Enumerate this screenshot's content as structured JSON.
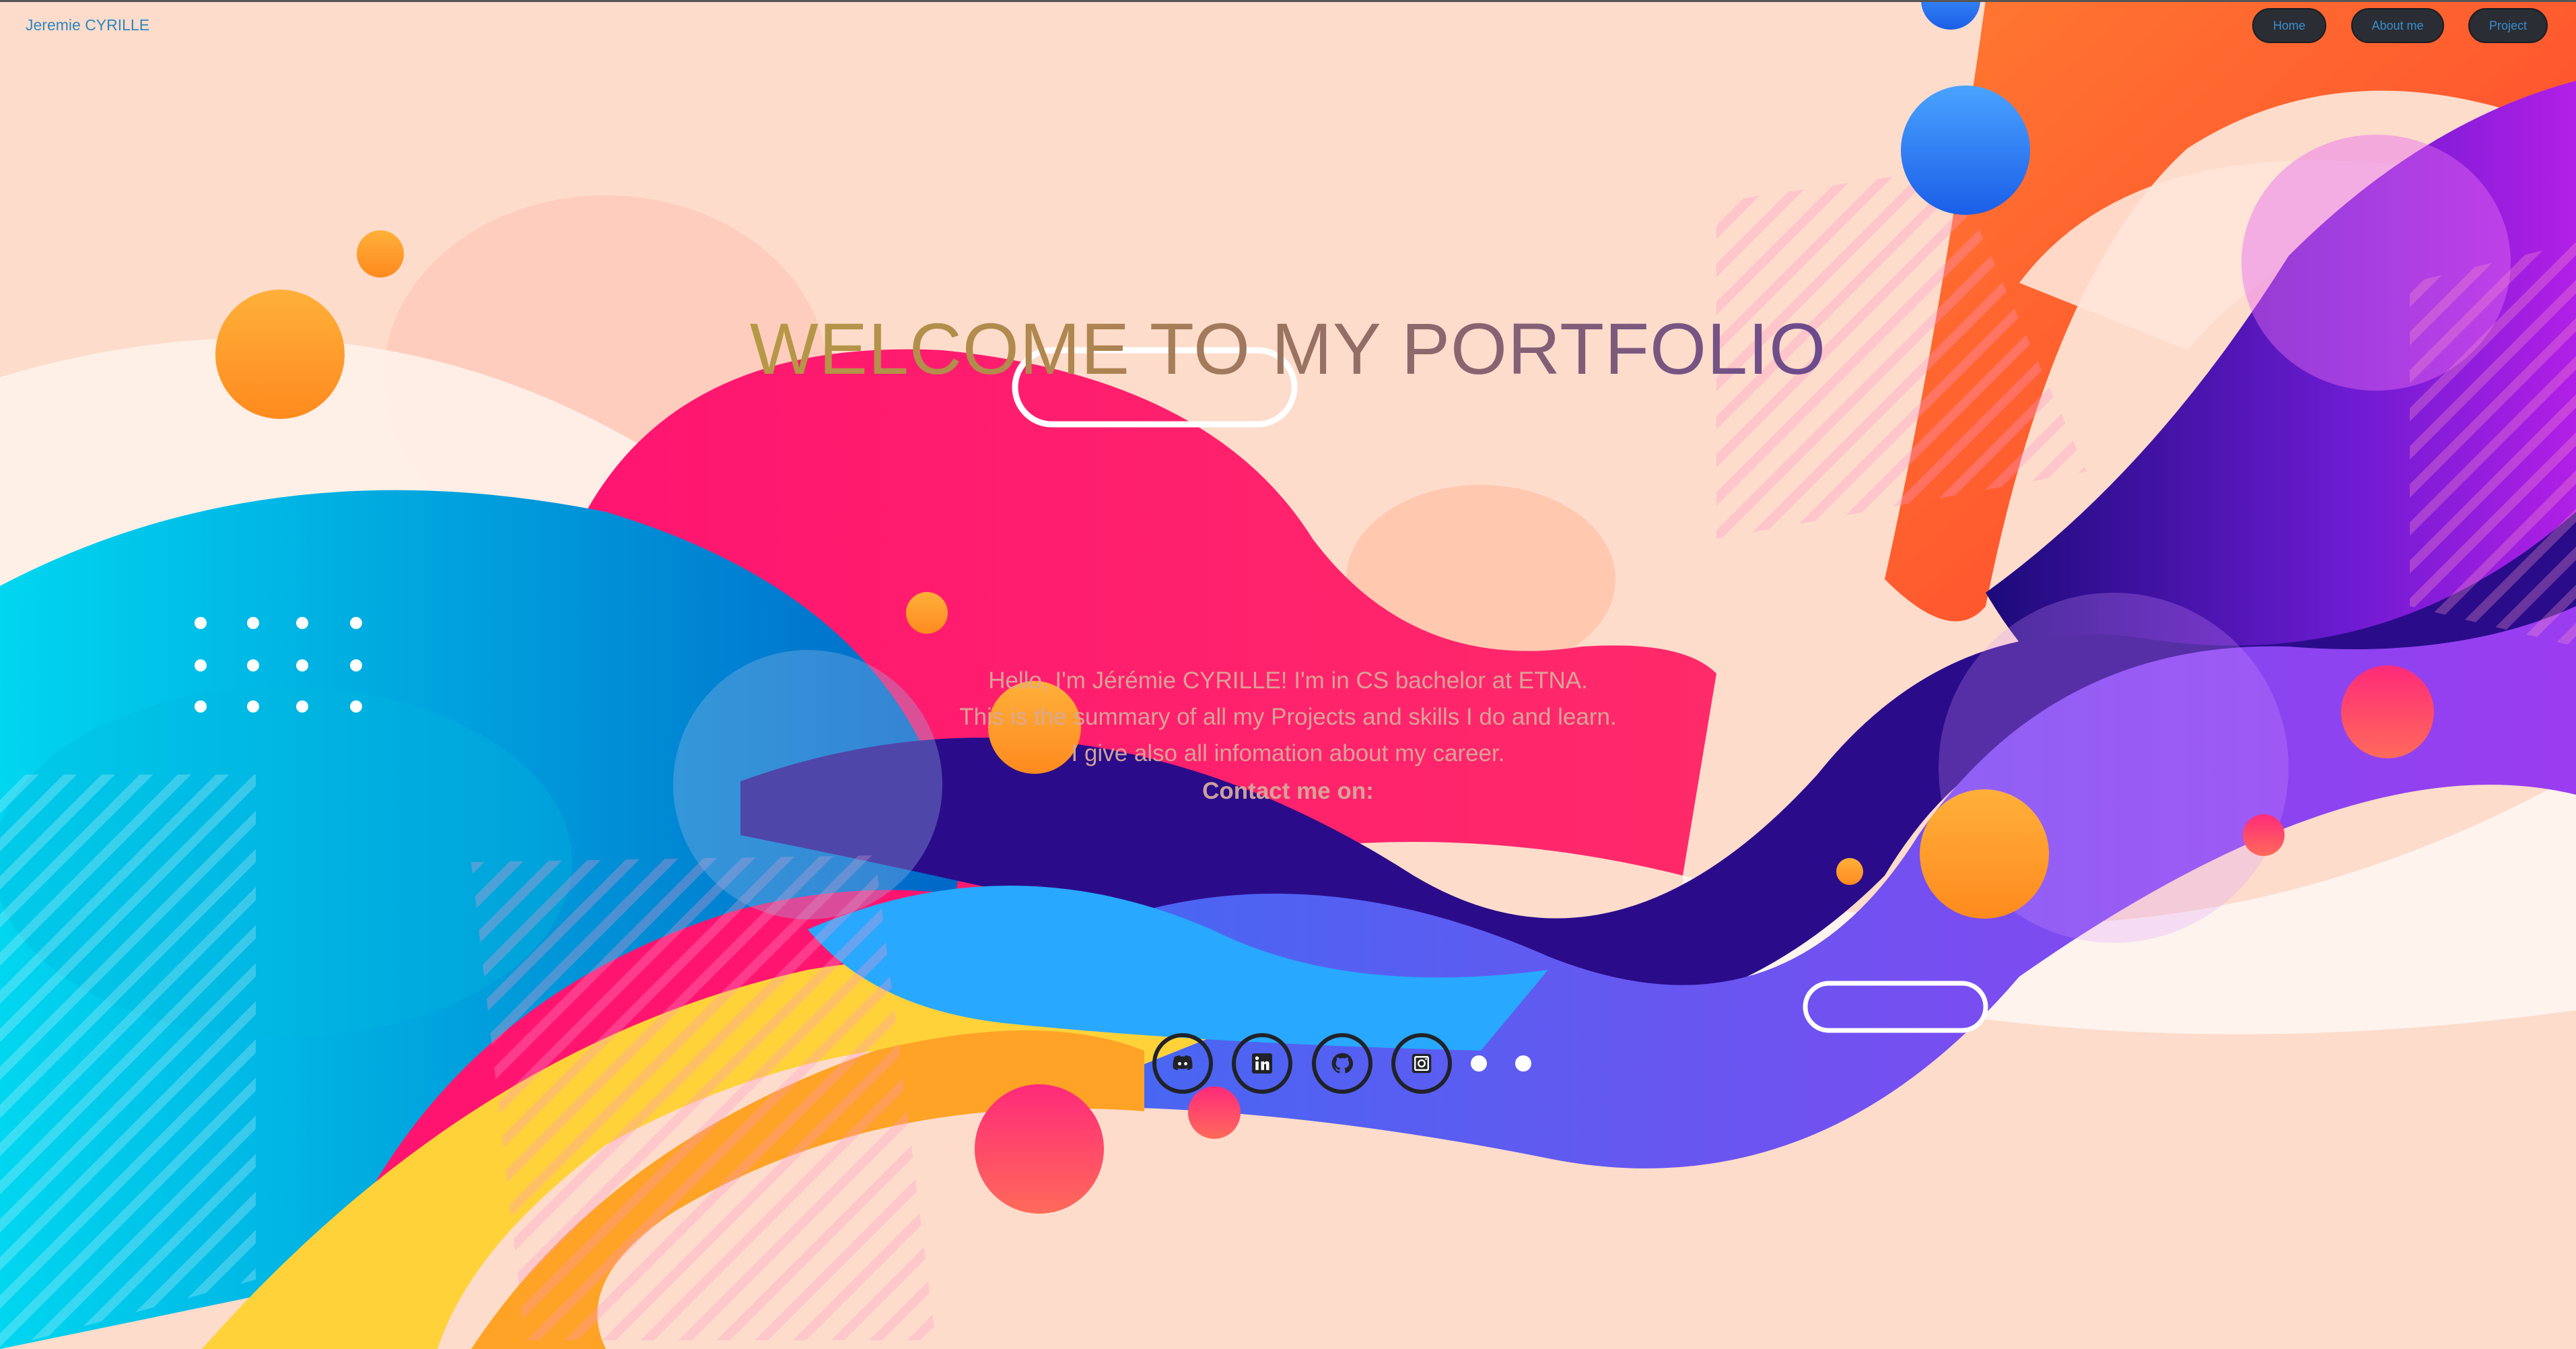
{
  "header": {
    "brand": "Jeremie CYRILLE",
    "nav": [
      {
        "label": "Home"
      },
      {
        "label": "About me"
      },
      {
        "label": "Project"
      }
    ]
  },
  "hero": {
    "title": "WELCOME TO MY PORTFOLIO",
    "intro_lines": [
      "Hello, I'm Jérémie CYRILLE! I'm in CS bachelor at ETNA.",
      "This is the summary of all my Projects and skills I do and learn.",
      "I give also all infomation about my career."
    ],
    "contact_label": "Contact me on:"
  },
  "socials": [
    {
      "icon": "discord-icon"
    },
    {
      "icon": "linkedin-icon"
    },
    {
      "icon": "github-icon"
    },
    {
      "icon": "instagram-icon"
    }
  ],
  "colors": {
    "background": "#fddccb",
    "nav_button": "#2a2d34",
    "link_blue": "#2e86c1",
    "pink": "#ff1a6e",
    "purple": "#7a1fd6",
    "cyan": "#00c8e8",
    "orange": "#ff9a2e"
  }
}
